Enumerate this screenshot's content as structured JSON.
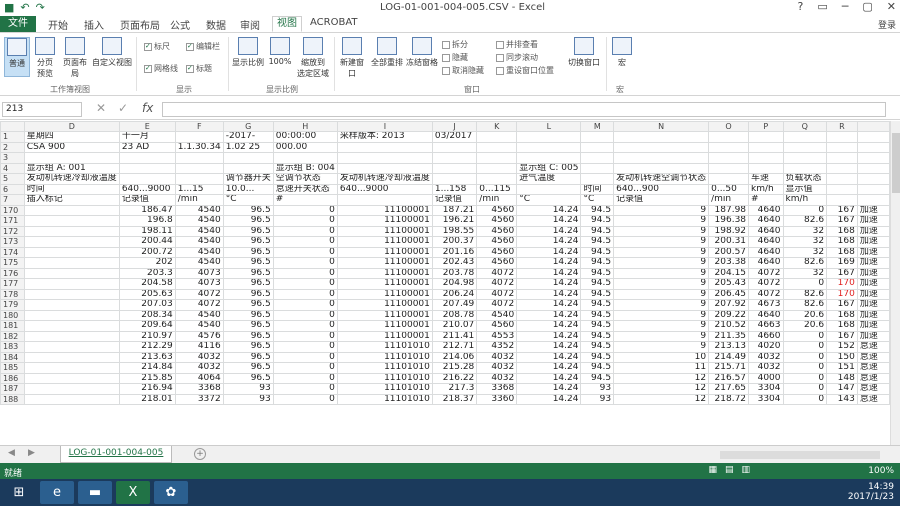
{
  "window": {
    "title": "LOG-01-001-004-005.CSV - Excel",
    "controls": [
      "?",
      "▭",
      "─",
      "▢",
      "✕"
    ]
  },
  "menu_tabs": [
    "文件",
    "开始",
    "插入",
    "页面布局",
    "公式",
    "数据",
    "审阅",
    "视图",
    "ACROBAT"
  ],
  "active_tab": "视图",
  "login": "登录",
  "ribbon": {
    "buttons": [
      {
        "label": "普通",
        "selected": true
      },
      {
        "label": "分页\n预览",
        "selected": false
      },
      {
        "label": "页面布局",
        "selected": false
      },
      {
        "label": "自定义视图",
        "selected": false
      },
      {
        "label": "显示比例",
        "selected": false
      },
      {
        "label": "100%",
        "selected": false
      },
      {
        "label": "缩放到\n选定区域",
        "selected": false
      },
      {
        "label": "新建窗口",
        "selected": false
      },
      {
        "label": "全部重排",
        "selected": false
      },
      {
        "label": "冻结窗格",
        "selected": false
      },
      {
        "label": "切换窗口",
        "selected": false
      },
      {
        "label": "宏",
        "selected": false
      }
    ],
    "checks": [
      {
        "label": "标尺",
        "on": true
      },
      {
        "label": "编辑栏",
        "on": true
      },
      {
        "label": "网格线",
        "on": true
      },
      {
        "label": "标题",
        "on": true
      }
    ],
    "window_opts": [
      "拆分",
      "隐藏",
      "取消隐藏",
      "并排查看",
      "同步滚动",
      "重设窗口位置"
    ],
    "groups": [
      "工作簿视图",
      "显示",
      "显示比例",
      "窗口",
      "宏"
    ]
  },
  "namebox": "213",
  "formula_btns": [
    "✕",
    "✓",
    "fx"
  ],
  "columns": [
    "",
    "D",
    "E",
    "F",
    "G",
    "H",
    "I",
    "J",
    "K",
    "L",
    "M",
    "N",
    "O",
    "P",
    "Q",
    "R"
  ],
  "rows": [
    {
      "rh": "1",
      "cells": [
        "星期四",
        "十一月",
        "",
        "-2017-",
        "00:00:00",
        "采样版本: 2013",
        "03/2017",
        "",
        "",
        "",
        "",
        "",
        "",
        "",
        ""
      ]
    },
    {
      "rh": "2",
      "cells": [
        "CSA 900",
        "23 AD",
        "1.1.30.34",
        "1.02 25",
        "000.00",
        "",
        "",
        "",
        "",
        "",
        "",
        "",
        "",
        "",
        ""
      ]
    },
    {
      "rh": "3",
      "cells": [
        "",
        "",
        "",
        "",
        "",
        "",
        "",
        "",
        "",
        "",
        "",
        "",
        "",
        "",
        ""
      ]
    },
    {
      "rh": "4",
      "cells": [
        "显示组 A: 001",
        "",
        "",
        "",
        "显示组 B: 004",
        "",
        "",
        "",
        "显示组 C: 005",
        "",
        "",
        "",
        "",
        "",
        ""
      ]
    },
    {
      "rh": "5",
      "cells": [
        "发动机转速冷却液温度",
        "",
        "",
        "调节器开关",
        "空调节状态",
        "发动机转速冷却液温度",
        "",
        "",
        "进气温度",
        "",
        "发动机转速空调节状态",
        "",
        "车速",
        "负载状态",
        ""
      ]
    },
    {
      "rh": "6",
      "cells": [
        "时间",
        "640...9000",
        "1...15",
        "10.0...",
        "怠速开关状态",
        "640...9000",
        "1...158",
        "0...115",
        "",
        "时间",
        "640...900",
        "0...50",
        "km/h",
        "显示值",
        ""
      ]
    },
    {
      "rh": "7",
      "cells": [
        "插入标记",
        "记录值",
        "/min",
        "°C",
        "#",
        "",
        "记录值",
        "/min",
        "°C",
        "°C",
        "记录值",
        "/min",
        "#",
        "km/h",
        ""
      ]
    },
    {
      "rh": "170",
      "cells": [
        "",
        "186.47",
        "4540",
        "96.5",
        "0",
        "11100001",
        "187.21",
        "4560",
        "14.24",
        "94.5",
        "9",
        "187.98",
        "4640",
        "0",
        "167",
        "加速"
      ]
    },
    {
      "rh": "171",
      "cells": [
        "",
        "196.8",
        "4540",
        "96.5",
        "0",
        "11100001",
        "196.21",
        "4560",
        "14.24",
        "94.5",
        "9",
        "196.38",
        "4640",
        "82.6",
        "167",
        "加速"
      ]
    },
    {
      "rh": "172",
      "cells": [
        "",
        "198.11",
        "4540",
        "96.5",
        "0",
        "11100001",
        "198.55",
        "4560",
        "14.24",
        "94.5",
        "9",
        "198.92",
        "4640",
        "32",
        "168",
        "加速"
      ]
    },
    {
      "rh": "173",
      "cells": [
        "",
        "200.44",
        "4540",
        "96.5",
        "0",
        "11100001",
        "200.37",
        "4560",
        "14.24",
        "94.5",
        "9",
        "200.31",
        "4640",
        "32",
        "168",
        "加速"
      ]
    },
    {
      "rh": "174",
      "cells": [
        "",
        "200.72",
        "4540",
        "96.5",
        "0",
        "11100001",
        "201.16",
        "4560",
        "14.24",
        "94.5",
        "9",
        "200.57",
        "4640",
        "32",
        "168",
        "加速"
      ]
    },
    {
      "rh": "175",
      "cells": [
        "",
        "202",
        "4540",
        "96.5",
        "0",
        "11100001",
        "202.43",
        "4560",
        "14.24",
        "94.5",
        "9",
        "203.38",
        "4640",
        "82.6",
        "169",
        "加速"
      ]
    },
    {
      "rh": "176",
      "cells": [
        "",
        "203.3",
        "4073",
        "96.5",
        "0",
        "11100001",
        "203.78",
        "4072",
        "14.24",
        "94.5",
        "9",
        "204.15",
        "4072",
        "32",
        "167",
        "加速"
      ]
    },
    {
      "rh": "177",
      "cells": [
        "",
        "204.58",
        "4073",
        "96.5",
        "0",
        "11100001",
        "204.98",
        "4072",
        "14.24",
        "94.5",
        "9",
        "205.43",
        "4072",
        "0",
        "170",
        "加速"
      ]
    },
    {
      "rh": "178",
      "cells": [
        "",
        "205.63",
        "4072",
        "96.5",
        "0",
        "11100001",
        "206.24",
        "4072",
        "14.24",
        "94.5",
        "9",
        "206.45",
        "4072",
        "82.6",
        "170",
        "加速"
      ]
    },
    {
      "rh": "179",
      "cells": [
        "",
        "207.03",
        "4072",
        "96.5",
        "0",
        "11100001",
        "207.49",
        "4072",
        "14.24",
        "94.5",
        "9",
        "207.92",
        "4673",
        "82.6",
        "167",
        "加速"
      ]
    },
    {
      "rh": "180",
      "cells": [
        "",
        "208.34",
        "4540",
        "96.5",
        "0",
        "11100001",
        "208.78",
        "4540",
        "14.24",
        "94.5",
        "9",
        "209.22",
        "4640",
        "20.6",
        "168",
        "加速"
      ]
    },
    {
      "rh": "181",
      "cells": [
        "",
        "209.64",
        "4540",
        "96.5",
        "0",
        "11100001",
        "210.07",
        "4560",
        "14.24",
        "94.5",
        "9",
        "210.52",
        "4663",
        "20.6",
        "168",
        "加速"
      ]
    },
    {
      "rh": "182",
      "cells": [
        "",
        "210.97",
        "4576",
        "96.5",
        "0",
        "11100001",
        "211.41",
        "4553",
        "14.24",
        "94.5",
        "9",
        "211.35",
        "4660",
        "0",
        "167",
        "加速"
      ]
    },
    {
      "rh": "183",
      "cells": [
        "",
        "212.29",
        "4116",
        "96.5",
        "0",
        "11101010",
        "212.71",
        "4352",
        "14.24",
        "94.5",
        "9",
        "213.13",
        "4020",
        "0",
        "152",
        "怠速"
      ]
    },
    {
      "rh": "184",
      "cells": [
        "",
        "213.63",
        "4032",
        "96.5",
        "0",
        "11101010",
        "214.06",
        "4032",
        "14.24",
        "94.5",
        "10",
        "214.49",
        "4032",
        "0",
        "150",
        "怠速"
      ]
    },
    {
      "rh": "185",
      "cells": [
        "",
        "214.84",
        "4032",
        "96.5",
        "0",
        "11101010",
        "215.28",
        "4032",
        "14.24",
        "94.5",
        "11",
        "215.71",
        "4032",
        "0",
        "151",
        "怠速"
      ]
    },
    {
      "rh": "186",
      "cells": [
        "",
        "215.85",
        "4064",
        "96.5",
        "0",
        "11101010",
        "216.22",
        "4032",
        "14.24",
        "94.5",
        "12",
        "216.57",
        "4000",
        "0",
        "148",
        "怠速"
      ]
    },
    {
      "rh": "187",
      "cells": [
        "",
        "216.94",
        "3368",
        "93",
        "0",
        "11101010",
        "217.3",
        "3368",
        "14.24",
        "93",
        "12",
        "217.65",
        "3304",
        "0",
        "147",
        "怠速"
      ]
    },
    {
      "rh": "188",
      "cells": [
        "",
        "218.01",
        "3372",
        "93",
        "0",
        "11101010",
        "218.37",
        "3360",
        "14.24",
        "93",
        "12",
        "218.72",
        "3304",
        "0",
        "143",
        "怠速"
      ]
    }
  ],
  "sheet_tab": "LOG-01-001-004-005",
  "add_sheet": "+",
  "status": {
    "left": "就绪",
    "zoom": "100%"
  },
  "tray": {
    "time": "14:39",
    "date": "2017/1/23"
  },
  "colors": {
    "excel_green": "#217346",
    "red": "#e02020",
    "taskbar": "#1b3a5c"
  }
}
